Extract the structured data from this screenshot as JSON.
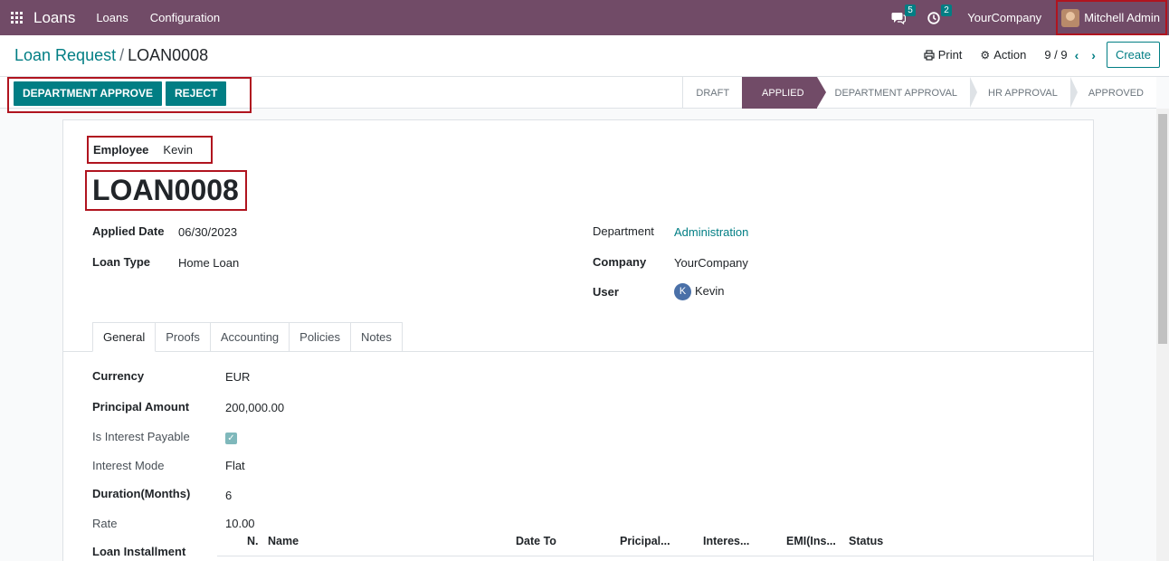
{
  "navbar": {
    "app_title": "Loans",
    "menu": [
      "Loans",
      "Configuration"
    ],
    "messages_count": "5",
    "activities_count": "2",
    "company": "YourCompany",
    "user": "Mitchell Admin"
  },
  "control_panel": {
    "breadcrumb_parent": "Loan Request",
    "breadcrumb_separator": "/",
    "breadcrumb_current": "LOAN0008",
    "print_label": "Print",
    "action_label": "Action",
    "pager": "9 / 9",
    "create_label": "Create"
  },
  "statusbar": {
    "buttons": [
      "DEPARTMENT APPROVE",
      "REJECT"
    ],
    "stages": [
      "DRAFT",
      "APPLIED",
      "DEPARTMENT APPROVAL",
      "HR APPROVAL",
      "APPROVED"
    ],
    "active_stage": "APPLIED"
  },
  "form": {
    "employee_label": "Employee",
    "employee_value": "Kevin",
    "title": "LOAN0008",
    "applied_date_label": "Applied Date",
    "applied_date_value": "06/30/2023",
    "loan_type_label": "Loan Type",
    "loan_type_value": "Home Loan",
    "department_label": "Department",
    "department_value": "Administration",
    "company_label": "Company",
    "company_value": "YourCompany",
    "user_label": "User",
    "user_initial": "K",
    "user_value": "Kevin"
  },
  "tabs": [
    "General",
    "Proofs",
    "Accounting",
    "Policies",
    "Notes"
  ],
  "general": {
    "currency_label": "Currency",
    "currency_value": "EUR",
    "principal_label": "Principal Amount",
    "principal_value": "200,000.00",
    "interest_payable_label": "Is Interest Payable",
    "interest_payable_checked": true,
    "interest_mode_label": "Interest Mode",
    "interest_mode_value": "Flat",
    "duration_label": "Duration(Months)",
    "duration_value": "6",
    "rate_label": "Rate",
    "rate_value": "10.00",
    "installment_label": "Loan Installment"
  },
  "installment_columns": [
    "N.",
    "Name",
    "Date To",
    "Pricipal...",
    "Interes...",
    "EMI(Ins...",
    "Status"
  ],
  "colors": {
    "navbar": "#714b67",
    "primary": "#017e84",
    "highlight_border": "#b0141f"
  }
}
